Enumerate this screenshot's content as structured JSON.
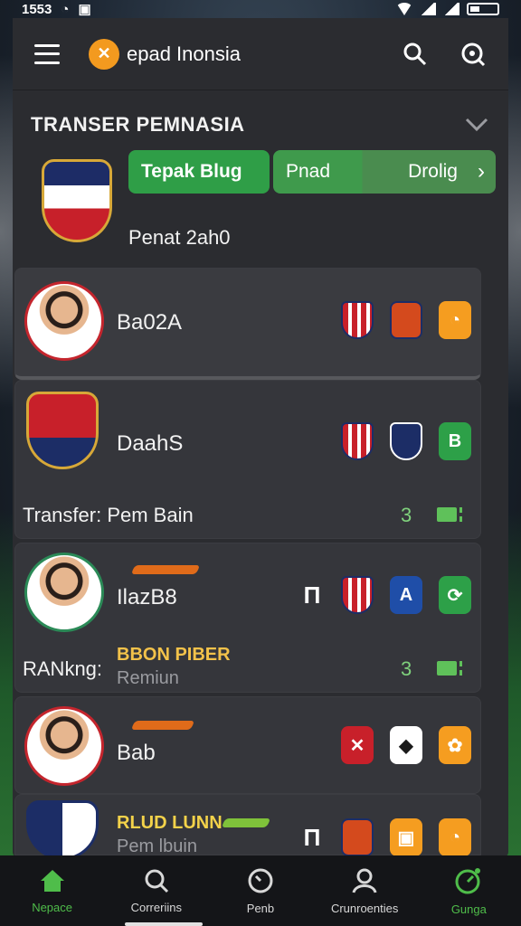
{
  "status": {
    "time": "1553"
  },
  "app": {
    "title": "epad Inonsia",
    "logo_glyph": "✕",
    "colors": {
      "accent": "#f39a1f",
      "primary": "#2f9e47"
    }
  },
  "section": {
    "title": "TRANSER PEMNASIA"
  },
  "team": {
    "pill_primary": "Tepak Blug",
    "pill_secondary_a": "Pnad",
    "pill_secondary_b": "Drolig",
    "subtitle": "Penat 2ah0"
  },
  "cards": [
    {
      "name": "Ba02A"
    },
    {
      "name": "DaahS",
      "line_label": "Transfer: Pem Bain",
      "count": "3",
      "badge_label": "B"
    },
    {
      "name": "IlazB8",
      "line_label": "RANkng:",
      "sub_title": "BBON PIBER",
      "sub_text": "Remiun",
      "count": "3",
      "badge_label": "A"
    },
    {
      "name": "Bab"
    },
    {
      "name": "",
      "sub_title": "RLUD LUNN",
      "sub_text": "Pem lbuin"
    }
  ],
  "nav": [
    {
      "label": "Nepace",
      "icon": "home-icon"
    },
    {
      "label": "Correriins",
      "icon": "search-icon"
    },
    {
      "label": "Penb",
      "icon": "clock-icon"
    },
    {
      "label": "Crunroenties",
      "icon": "users-icon"
    },
    {
      "label": "Gunga",
      "icon": "stopwatch-icon"
    }
  ]
}
